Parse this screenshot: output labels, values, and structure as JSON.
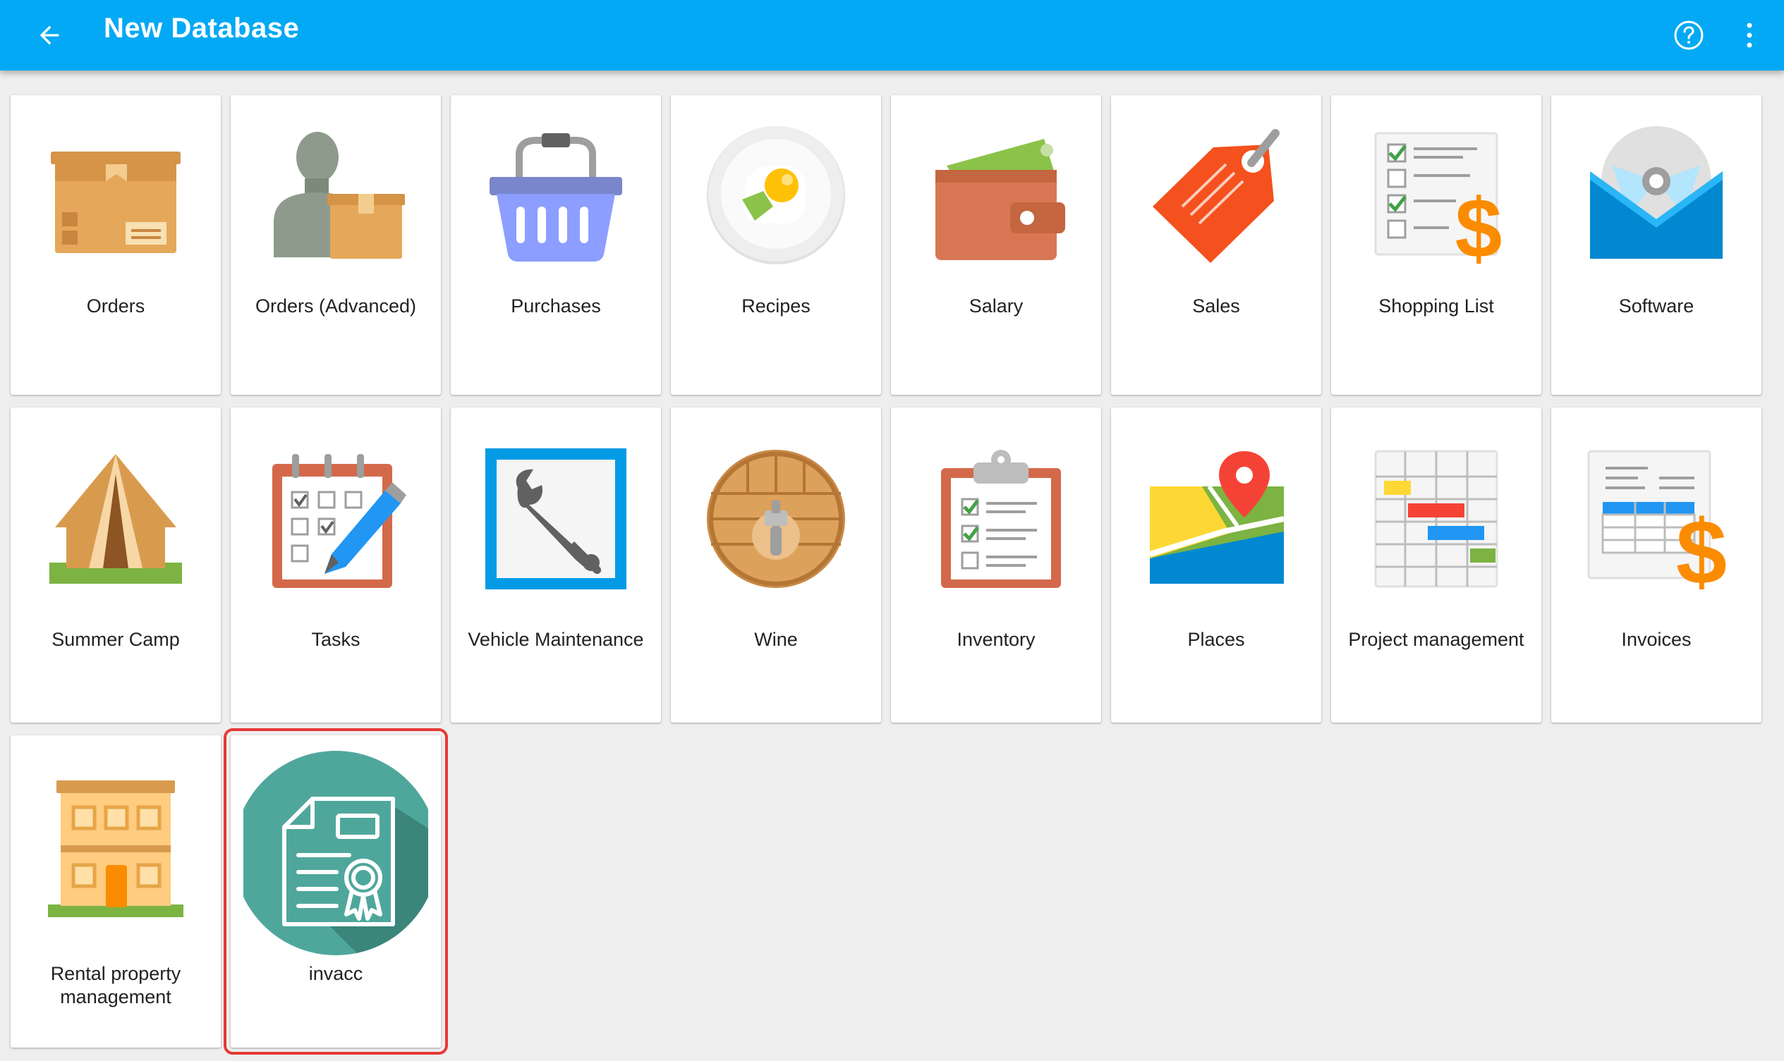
{
  "appbar": {
    "title": "New Database",
    "back_icon": "arrow-back-icon",
    "help_icon": "help-circle-icon",
    "menu_icon": "more-vert-icon",
    "color": "#03a9f4"
  },
  "templates": [
    {
      "label": "Orders",
      "icon": "box-icon"
    },
    {
      "label": "Orders (Advanced)",
      "icon": "person-box-icon"
    },
    {
      "label": "Purchases",
      "icon": "basket-icon"
    },
    {
      "label": "Recipes",
      "icon": "plate-egg-icon"
    },
    {
      "label": "Salary",
      "icon": "wallet-icon"
    },
    {
      "label": "Sales",
      "icon": "price-tag-icon"
    },
    {
      "label": "Shopping List",
      "icon": "checklist-dollar-icon"
    },
    {
      "label": "Software",
      "icon": "cd-envelope-icon"
    },
    {
      "label": "Summer Camp",
      "icon": "tent-icon"
    },
    {
      "label": "Tasks",
      "icon": "calendar-pencil-icon"
    },
    {
      "label": "Vehicle Maintenance",
      "icon": "wrench-icon"
    },
    {
      "label": "Wine",
      "icon": "barrel-icon"
    },
    {
      "label": "Inventory",
      "icon": "clipboard-icon"
    },
    {
      "label": "Places",
      "icon": "map-pin-icon"
    },
    {
      "label": "Project management",
      "icon": "gantt-icon"
    },
    {
      "label": "Invoices",
      "icon": "invoice-dollar-icon"
    },
    {
      "label": "Rental property management",
      "label_line1": "Rental property",
      "label_line2": "management",
      "icon": "building-icon"
    },
    {
      "label": "invacc",
      "icon": "certificate-icon"
    }
  ],
  "selected_template": "invacc",
  "colors": {
    "selection_outline": "#e53935",
    "background": "#eeeeee"
  }
}
